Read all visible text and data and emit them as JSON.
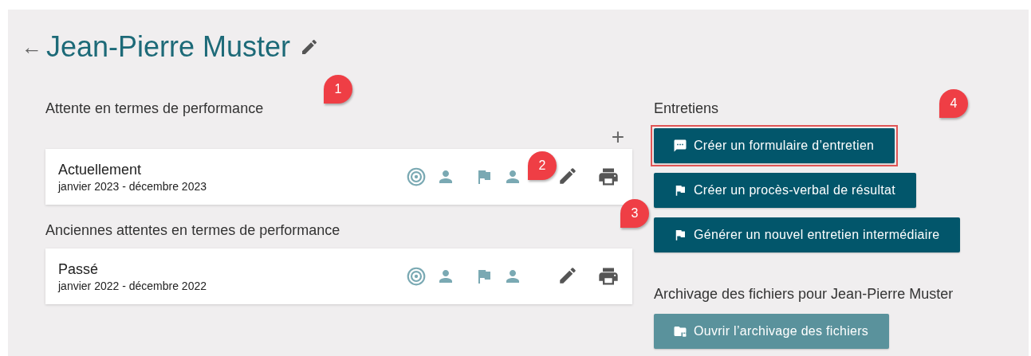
{
  "header": {
    "back": "←",
    "title": "Jean-Pierre Muster"
  },
  "current_section": {
    "title": "Attente en termes de performance",
    "add": "+",
    "items": [
      {
        "title": "Actuellement",
        "period": "janvier 2023 - décembre 2023"
      }
    ]
  },
  "past_section": {
    "title": "Anciennes attentes en termes de performance",
    "items": [
      {
        "title": "Passé",
        "period": "janvier 2022 - décembre 2022"
      }
    ]
  },
  "interviews": {
    "title": "Entretiens",
    "buttons": [
      {
        "label": "Créer un formulaire d’entretien",
        "kind": "chat",
        "highlighted": true,
        "disabled": false
      },
      {
        "label": "Créer un procès-verbal de résultat",
        "kind": "flag",
        "highlighted": false,
        "disabled": false
      },
      {
        "label": "Générer un nouvel entretien intermédiaire",
        "kind": "flag",
        "highlighted": false,
        "disabled": false
      }
    ]
  },
  "archive": {
    "title": "Archivage des fichiers pour Jean-Pierre Muster",
    "buttons": [
      {
        "label": "Ouvrir l’archivage des fichiers",
        "kind": "folder",
        "highlighted": false,
        "disabled": true
      }
    ]
  },
  "callouts": [
    {
      "label": "1"
    },
    {
      "label": "2"
    },
    {
      "label": "3"
    },
    {
      "label": "4"
    }
  ]
}
